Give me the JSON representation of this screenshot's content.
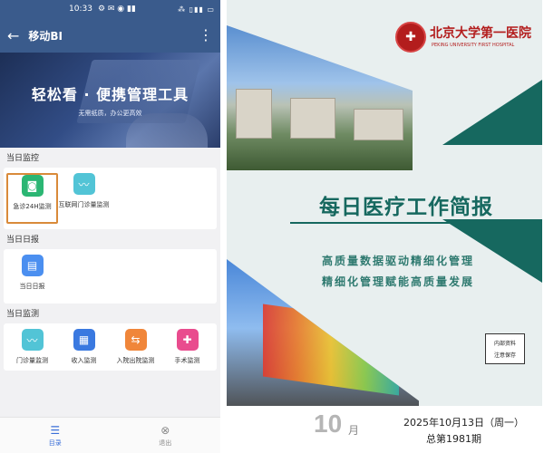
{
  "phone": {
    "status_time": "10:33",
    "status_icons": "⚙ ✉ ◉ ▮▮",
    "title": "移动BI",
    "banner": {
      "title": "轻松看 · 便携管理工具",
      "subtitle": "无需纸质，办公更高效"
    },
    "sections": [
      {
        "label": "当日监控",
        "tiles": [
          {
            "label": "急诊24H监测",
            "icon": "camera-icon",
            "color": "#2bb673",
            "selected": true
          },
          {
            "label": "互联网门诊量监测",
            "icon": "monitor-chart-icon",
            "color": "#52c4d6",
            "selected": false
          }
        ]
      },
      {
        "label": "当日日报",
        "tiles": [
          {
            "label": "当日日报",
            "icon": "document-icon",
            "color": "#4b8ff0",
            "selected": false
          }
        ]
      },
      {
        "label": "当日监测",
        "tiles": [
          {
            "label": "门诊量监测",
            "icon": "chart-icon",
            "color": "#52c4d6",
            "selected": false
          },
          {
            "label": "收入监测",
            "icon": "receipt-icon",
            "color": "#3a79e0",
            "selected": false
          },
          {
            "label": "入院出院监测",
            "icon": "transfer-icon",
            "color": "#f0863a",
            "selected": false
          },
          {
            "label": "手术监测",
            "icon": "surgery-icon",
            "color": "#e94c8e",
            "selected": false
          }
        ]
      }
    ],
    "tabs": [
      {
        "label": "目录",
        "icon": "list-icon",
        "active": true
      },
      {
        "label": "退出",
        "icon": "exit-icon",
        "active": false
      }
    ]
  },
  "brochure": {
    "hospital_name_cn": "北京大学第一医院",
    "hospital_name_en": "PEKING UNIVERSITY FIRST HOSPITAL",
    "title": "每日医疗工作简报",
    "slogan_1": "高质量数据驱动精细化管理",
    "slogan_2": "精细化管理赋能高质量发展",
    "internal_tag_1": "内部资料",
    "internal_tag_2": "注意保存",
    "month": "10",
    "month_suffix": "月",
    "date": "2025年10月13日（周一）",
    "issue": "总第1981期",
    "colors": {
      "teal": "#16685f",
      "brand_red": "#b31d1d"
    }
  }
}
